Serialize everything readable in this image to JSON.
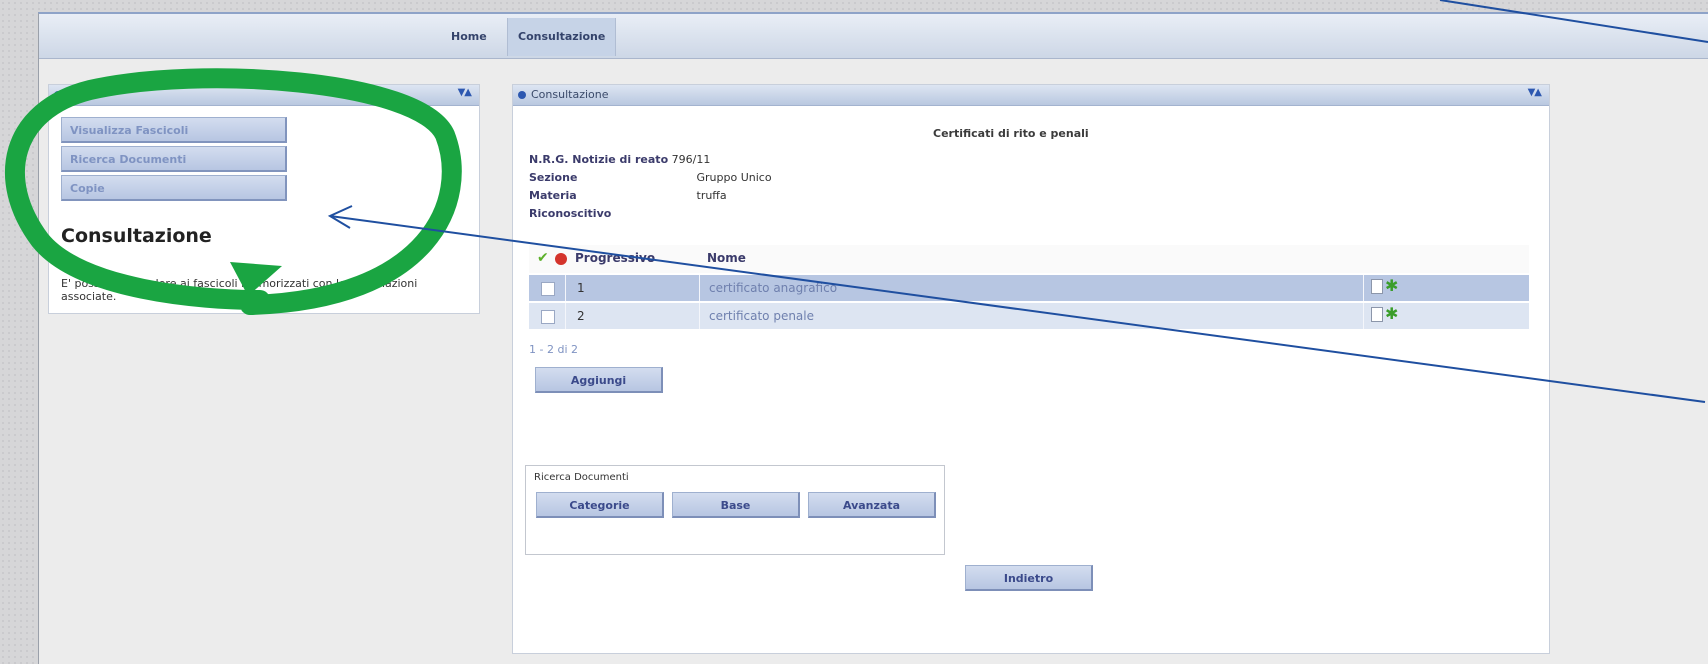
{
  "nav": {
    "home": "Home",
    "consultazione": "Consultazione"
  },
  "left_panel": {
    "title": "",
    "menu": [
      "Visualizza Fascicoli",
      "Ricerca Documenti",
      "Copie"
    ],
    "heading": "Consultazione",
    "description": "E' possibile accedere ai fascicoli memorizzati con le informazioni associate."
  },
  "right_panel": {
    "title": "Consultazione",
    "doc_title": "Certificati di rito e penali",
    "fields": [
      {
        "label": "N.R.G. Notizie di reato",
        "value": "796/11"
      },
      {
        "label": "Sezione",
        "value": "Gruppo Unico"
      },
      {
        "label": "Materia",
        "value": "truffa"
      },
      {
        "label": "Riconoscitivo",
        "value": ""
      }
    ],
    "table": {
      "headers": [
        "Progressivo",
        "Nome"
      ],
      "rows": [
        {
          "progressivo": "1",
          "nome": "certificato anagrafico"
        },
        {
          "progressivo": "2",
          "nome": "certificato penale"
        }
      ]
    },
    "pager": "1 - 2 di 2",
    "add_button": "Aggiungi",
    "search": {
      "label": "Ricerca Documenti",
      "buttons": [
        "Categorie",
        "Base",
        "Avanzata"
      ]
    },
    "back_button": "Indietro"
  },
  "colors": {
    "highlight_ellipse": "#1aa542",
    "arrow": "#1f4fa0"
  }
}
